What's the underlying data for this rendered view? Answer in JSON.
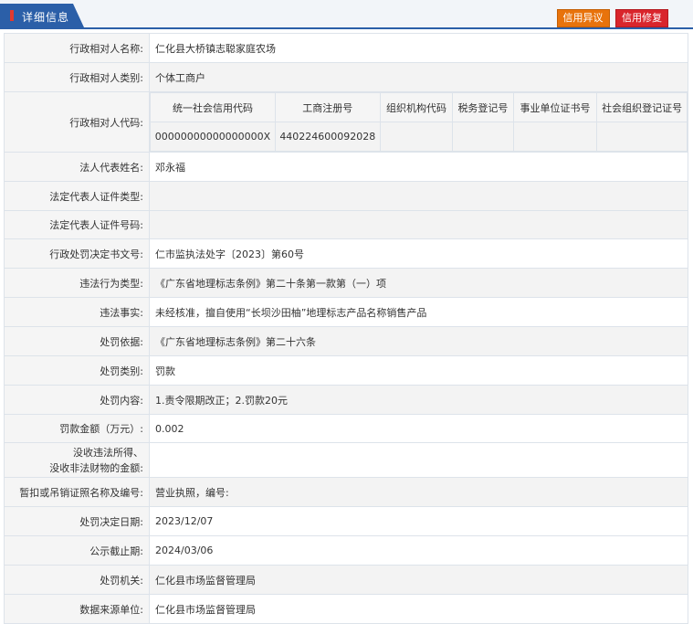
{
  "header": {
    "tab_title": "详细信息",
    "objection_label": "信用异议",
    "repair_label": "信用修复"
  },
  "rows": [
    {
      "label": "行政相对人名称:",
      "value": "仁化县大桥镇志聪家庭农场"
    },
    {
      "label": "行政相对人类别:",
      "value": "个体工商户"
    },
    {
      "label": "行政相对人代码:",
      "value": ""
    },
    {
      "label": "法人代表姓名:",
      "value": "邓永福"
    },
    {
      "label": "法定代表人证件类型:",
      "value": ""
    },
    {
      "label": "法定代表人证件号码:",
      "value": ""
    },
    {
      "label": "行政处罚决定书文号:",
      "value": "仁市监执法处字〔2023〕第60号"
    },
    {
      "label": "违法行为类型:",
      "value": "《广东省地理标志条例》第二十条第一款第（一）项"
    },
    {
      "label": "违法事实:",
      "value": "未经核准，擅自使用“长坝沙田柚”地理标志产品名称销售产品"
    },
    {
      "label": "处罚依据:",
      "value": "《广东省地理标志条例》第二十六条"
    },
    {
      "label": "处罚类别:",
      "value": "罚款"
    },
    {
      "label": "处罚内容:",
      "value": "1.责令限期改正；2.罚款20元"
    },
    {
      "label": "罚款金额（万元）:",
      "value": "0.002"
    },
    {
      "label_line1": "没收违法所得、",
      "label_line2": "没收非法财物的金额:",
      "value": ""
    },
    {
      "label": "暂扣或吊销证照名称及编号:",
      "value": "营业执照，编号:"
    },
    {
      "label": "处罚决定日期:",
      "value": "2023/12/07"
    },
    {
      "label": "公示截止期:",
      "value": "2024/03/06"
    },
    {
      "label": "处罚机关:",
      "value": "仁化县市场监督管理局"
    },
    {
      "label": "数据来源单位:",
      "value": "仁化县市场监督管理局"
    }
  ],
  "codes": {
    "headers": [
      "统一社会信用代码",
      "工商注册号",
      "组织机构代码",
      "税务登记号",
      "事业单位证书号",
      "社会组织登记证号"
    ],
    "values": [
      "00000000000000000X",
      "440224600092028",
      "",
      "",
      "",
      ""
    ]
  },
  "colors": {
    "header_blue": "#2b5fa8",
    "objection_orange": "#e8730c",
    "repair_red": "#d9252c",
    "label_bg": "#f5f5f5",
    "border": "#dde3ea"
  }
}
